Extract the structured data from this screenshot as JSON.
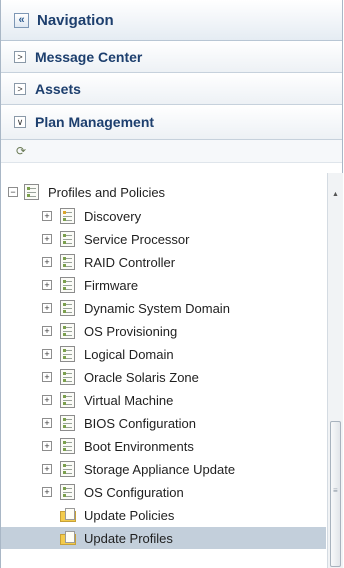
{
  "navigation": {
    "title": "Navigation",
    "collapse_glyph": "«"
  },
  "accordions": [
    {
      "label": "Message Center",
      "toggle": ">"
    },
    {
      "label": "Assets",
      "toggle": ">"
    },
    {
      "label": "Plan Management",
      "toggle": "∨"
    }
  ],
  "toolbar": {
    "refresh_glyph": "⟳"
  },
  "tree": {
    "root": {
      "label": "Profiles and Policies",
      "expander": "−"
    },
    "items": [
      {
        "label": "Discovery",
        "expander": "+"
      },
      {
        "label": "Service Processor",
        "expander": "+"
      },
      {
        "label": "RAID Controller",
        "expander": "+"
      },
      {
        "label": "Firmware",
        "expander": "+"
      },
      {
        "label": "Dynamic System Domain",
        "expander": "+"
      },
      {
        "label": "OS Provisioning",
        "expander": "+"
      },
      {
        "label": "Logical Domain",
        "expander": "+"
      },
      {
        "label": "Oracle Solaris Zone",
        "expander": "+"
      },
      {
        "label": "Virtual Machine",
        "expander": "+"
      },
      {
        "label": "BIOS Configuration",
        "expander": "+"
      },
      {
        "label": "Boot Environments",
        "expander": "+"
      },
      {
        "label": "Storage Appliance Update",
        "expander": "+"
      },
      {
        "label": "OS Configuration",
        "expander": "+"
      }
    ],
    "leaves": [
      {
        "label": "Update Policies"
      },
      {
        "label": "Update Profiles",
        "selected": true
      }
    ]
  },
  "scrollbar": {
    "up_glyph": "▲",
    "grip_glyph": "≡"
  }
}
